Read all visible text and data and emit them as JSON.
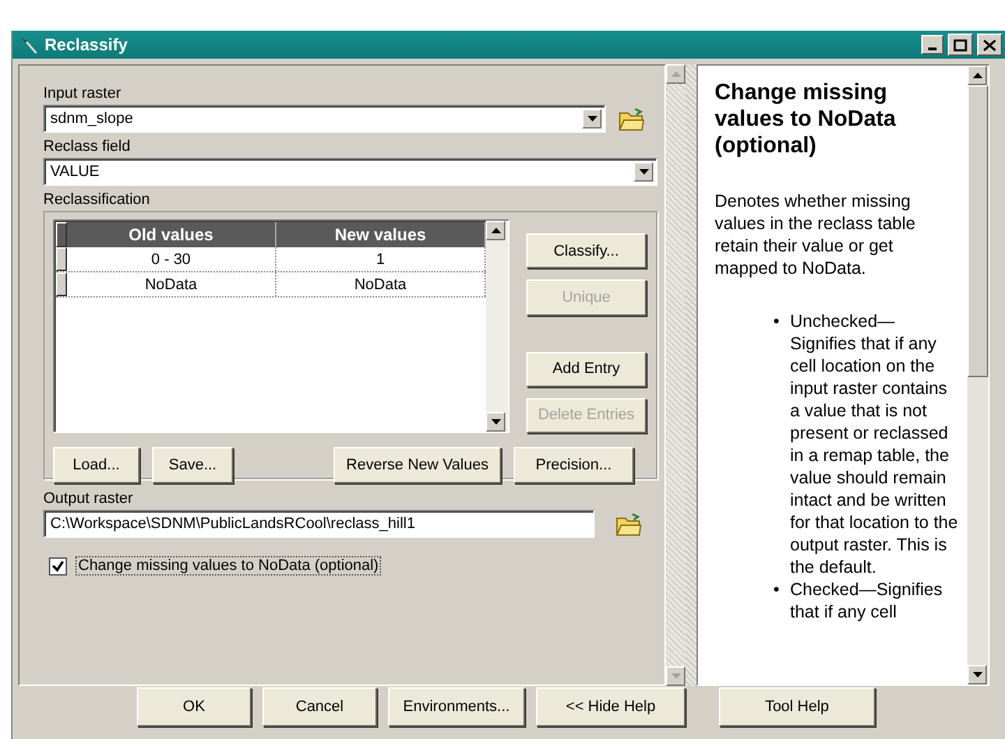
{
  "window": {
    "title": "Reclassify"
  },
  "input_raster": {
    "label": "Input raster",
    "value": "sdnm_slope"
  },
  "reclass_field": {
    "label": "Reclass field",
    "value": "VALUE"
  },
  "reclassification": {
    "label": "Reclassification",
    "columns": [
      "Old values",
      "New values"
    ],
    "rows": [
      [
        "0 - 30",
        "1"
      ],
      [
        "NoData",
        "NoData"
      ]
    ],
    "side_buttons": [
      {
        "label": "Classify...",
        "disabled": false
      },
      {
        "label": "Unique",
        "disabled": true
      },
      {
        "label": "Add Entry",
        "disabled": false
      },
      {
        "label": "Delete Entries",
        "disabled": true
      }
    ],
    "bottom_buttons": [
      {
        "label": "Load..."
      },
      {
        "label": "Save..."
      },
      {
        "label": "Reverse New Values"
      },
      {
        "label": "Precision..."
      }
    ]
  },
  "output_raster": {
    "label": "Output raster",
    "value": "C:\\Workspace\\SDNM\\PublicLandsRCool\\reclass_hill1"
  },
  "missing_to_nodata": {
    "label": "Change missing values to NoData (optional)",
    "checked": true
  },
  "help": {
    "title": "Change missing values to NoData (optional)",
    "intro": "Denotes whether missing values in the reclass table retain their value or get mapped to NoData.",
    "bullets": [
      {
        "marker": "•",
        "text": "Unchecked—Signifies that if any cell location on the input raster contains a value that is not present or reclassed in a remap table, the value should remain intact and be written for that location to the output raster. This is the default."
      },
      {
        "marker": "•",
        "text": "Checked—Signifies that if any cell"
      }
    ]
  },
  "buttons": [
    {
      "label": "OK"
    },
    {
      "label": "Cancel"
    },
    {
      "label": "Environments..."
    },
    {
      "label": "<< Hide Help"
    },
    {
      "label": "Tool Help"
    }
  ]
}
